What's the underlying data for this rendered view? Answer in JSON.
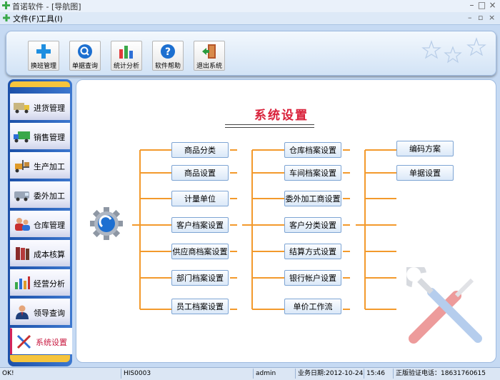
{
  "window": {
    "app_name": "首诺软件",
    "separator": " - ",
    "doc_title": "[导航图]"
  },
  "menu": [
    {
      "label": "文件(F)"
    },
    {
      "label": "工具(I)"
    }
  ],
  "toolbar": [
    {
      "label": "换班管理",
      "icon": "plus-icon"
    },
    {
      "label": "单据查询",
      "icon": "magnifier-icon"
    },
    {
      "label": "统计分析",
      "icon": "bar-chart-icon"
    },
    {
      "label": "软件帮助",
      "icon": "help-icon"
    },
    {
      "label": "退出系统",
      "icon": "exit-door-icon"
    }
  ],
  "nav": [
    {
      "label": "进货管理",
      "icon": "truck-icon"
    },
    {
      "label": "销售管理",
      "icon": "delivery-truck-icon"
    },
    {
      "label": "生产加工",
      "icon": "forklift-icon"
    },
    {
      "label": "委外加工",
      "icon": "van-icon"
    },
    {
      "label": "仓库管理",
      "icon": "users-icon"
    },
    {
      "label": "成本核算",
      "icon": "books-icon"
    },
    {
      "label": "经营分析",
      "icon": "chart-icon"
    },
    {
      "label": "领导查询",
      "icon": "leader-icon"
    },
    {
      "label": "系统设置",
      "icon": "tools-icon",
      "active": true
    }
  ],
  "main": {
    "title": "系统设置",
    "col1": [
      "商品分类",
      "商品设置",
      "计量单位",
      "客户档案设置",
      "供应商档案设置",
      "部门档案设置",
      "员工档案设置"
    ],
    "col2": [
      "仓库档案设置",
      "车间档案设置",
      "委外加工商设置",
      "客户分类设置",
      "结算方式设置",
      "银行帐户设置",
      "单价工作流"
    ],
    "col3": [
      "编码方案",
      "单据设置"
    ]
  },
  "status": {
    "ok": "OK!",
    "code": "HIS0003",
    "user": "admin",
    "biz_date": "业务日期:2012-10-24",
    "time": "15:46",
    "phone": "正版验证电话：18631760615"
  },
  "colors": {
    "accent_orange": "#f39a2c",
    "nav_blue": "#2a62bd",
    "title_red": "#d9213a"
  }
}
